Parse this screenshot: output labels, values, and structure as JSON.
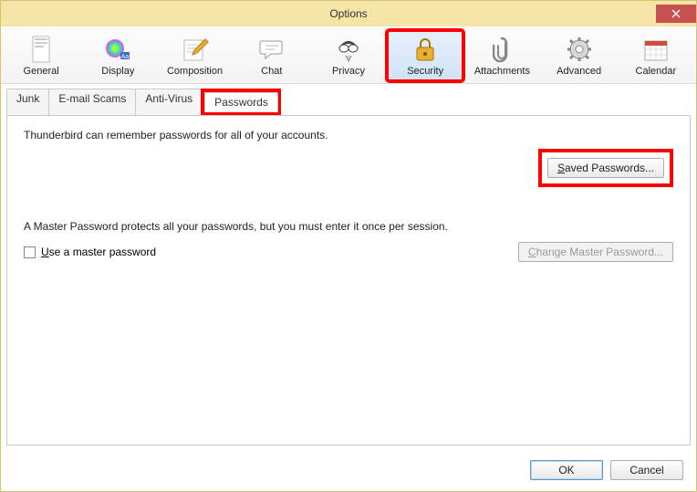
{
  "window": {
    "title": "Options"
  },
  "toolbar": {
    "items": [
      {
        "label": "General"
      },
      {
        "label": "Display"
      },
      {
        "label": "Composition"
      },
      {
        "label": "Chat"
      },
      {
        "label": "Privacy"
      },
      {
        "label": "Security"
      },
      {
        "label": "Attachments"
      },
      {
        "label": "Advanced"
      },
      {
        "label": "Calendar"
      }
    ],
    "selected_index": 5
  },
  "subtabs": {
    "items": [
      {
        "label": "Junk"
      },
      {
        "label": "E-mail Scams"
      },
      {
        "label": "Anti-Virus"
      },
      {
        "label": "Passwords"
      }
    ],
    "active_index": 3
  },
  "pane": {
    "remember_text": "Thunderbird can remember passwords for all of your accounts.",
    "saved_btn": "Saved Passwords...",
    "master_desc": "A Master Password protects all your passwords, but you must enter it once per session.",
    "use_master_prefix": "U",
    "use_master_rest": "se a master password",
    "use_master_checked": false,
    "change_master_btn": "Change Master Password..."
  },
  "footer": {
    "ok": "OK",
    "cancel": "Cancel"
  }
}
